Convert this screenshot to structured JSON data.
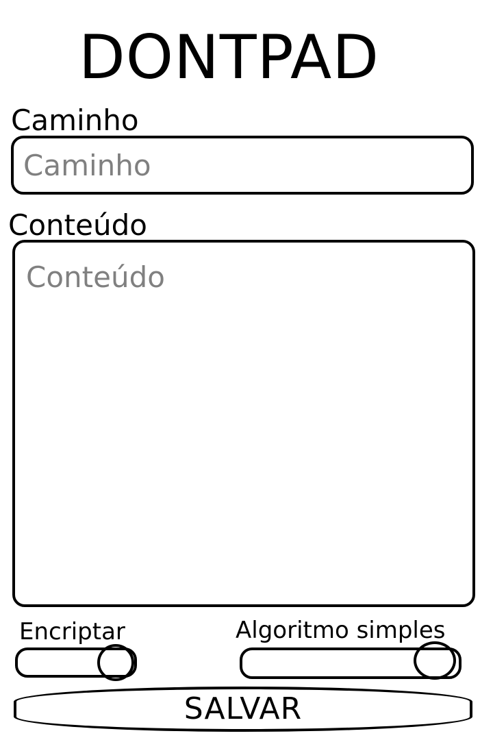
{
  "app": {
    "title": "DONTPAD"
  },
  "form": {
    "path": {
      "label": "Caminho",
      "placeholder": "Caminho",
      "value": ""
    },
    "content": {
      "label": "Conteúdo",
      "placeholder": "Conteúdo",
      "value": ""
    }
  },
  "toggles": {
    "encrypt": {
      "label": "Encriptar",
      "enabled": true
    },
    "simple_algorithm": {
      "label": "Algoritmo simples",
      "enabled": true
    }
  },
  "actions": {
    "save_label": "SALVAR"
  }
}
